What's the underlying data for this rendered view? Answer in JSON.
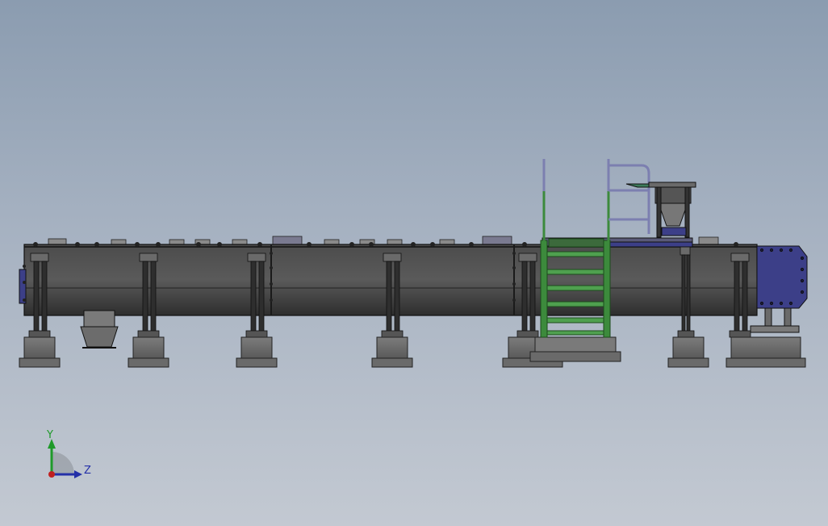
{
  "viewport": {
    "background_top": "#8b9cb0",
    "background_bottom": "#c3c9d2"
  },
  "model": {
    "body_color": "#545454",
    "support_color": "#3a3a3a",
    "base_color": "#6e6e6e",
    "stairs_color": "#3c8a3c",
    "drive_color": "#3c3f88",
    "rail_color": "#7c7fb0"
  },
  "triad": {
    "y_label": "Y",
    "z_label": "Z",
    "y_color": "#1f9a2a",
    "z_color": "#2430a8",
    "origin_color": "#c02020"
  }
}
